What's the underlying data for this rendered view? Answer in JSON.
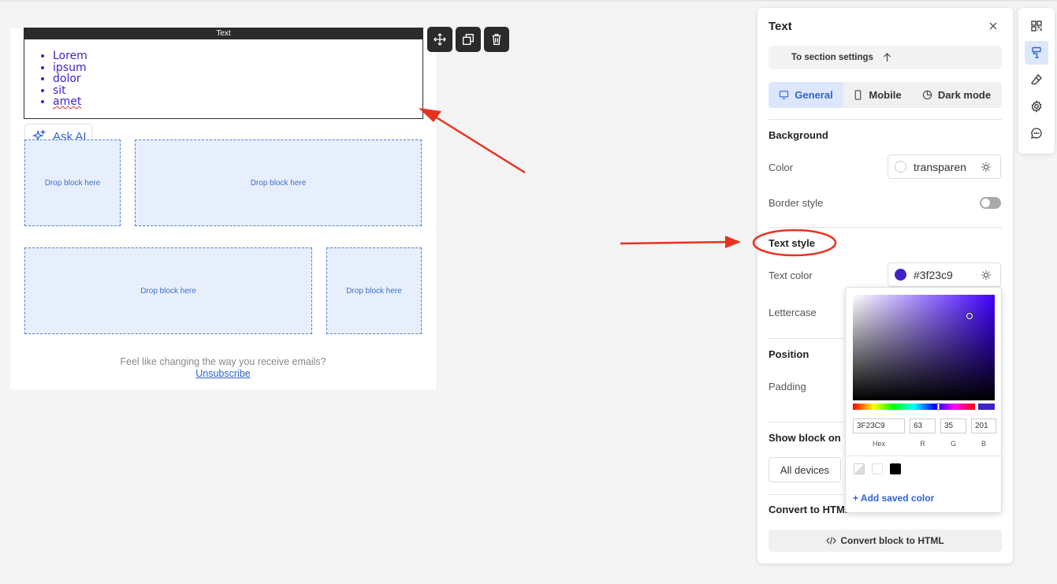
{
  "canvas": {
    "text_block": {
      "header": "Text",
      "items": [
        "Lorem",
        "ipsum",
        "dolor",
        "sit",
        "amet"
      ],
      "text_color": "#3f23c9"
    },
    "ask_ai": "Ask AI",
    "drop_blocks": [
      "Drop block here",
      "Drop block here",
      "Drop block here",
      "Drop block here"
    ],
    "footer": {
      "text": "Feel like changing the way you receive emails?",
      "link": "Unsubscribe"
    }
  },
  "panel": {
    "title": "Text",
    "section_settings": "To section settings",
    "tabs": [
      {
        "label": "General",
        "active": true
      },
      {
        "label": "Mobile",
        "active": false
      },
      {
        "label": "Dark mode",
        "active": false
      }
    ],
    "background": {
      "heading": "Background",
      "color_label": "Color",
      "color_value": "transparen",
      "border_style_label": "Border style"
    },
    "text_style": {
      "heading": "Text style",
      "text_color_label": "Text color",
      "text_color_value": "#3f23c9",
      "lettercase_label": "Lettercase"
    },
    "position": {
      "heading": "Position",
      "padding_label": "Padding"
    },
    "show_block": {
      "heading": "Show block on",
      "all_devices": "All devices"
    },
    "convert": {
      "heading": "Convert to HTML",
      "button": "Convert block to HTML"
    }
  },
  "color_picker": {
    "hex": "3F23C9",
    "r": "63",
    "g": "35",
    "b": "201",
    "labels": {
      "hex": "Hex",
      "r": "R",
      "g": "G",
      "b": "B"
    },
    "saved_colors": [
      "#e8e8e8",
      "#ffffff",
      "#000000"
    ],
    "add_saved": "+ Add saved color"
  },
  "rail_icons": [
    "grid-icon",
    "paint-roller-icon",
    "eraser-icon",
    "gear-icon",
    "chat-icon"
  ],
  "colors": {
    "accent": "#2f62d6",
    "annotation": "#e8321e"
  }
}
